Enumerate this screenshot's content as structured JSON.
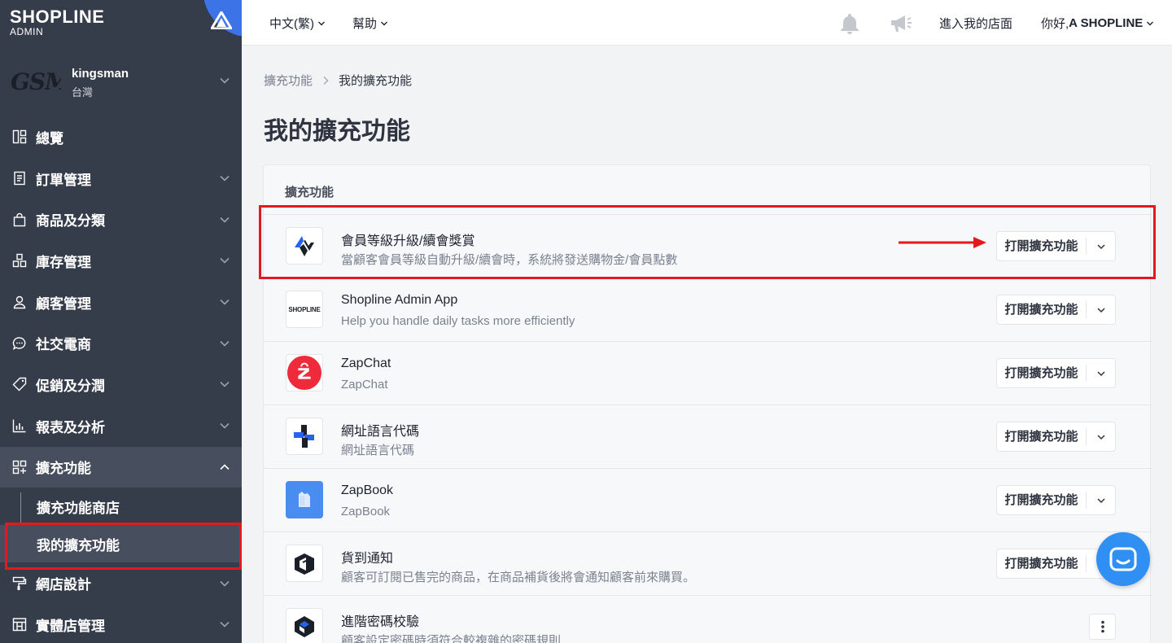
{
  "brand": {
    "name": "SHOPLINE",
    "sub": "ADMIN"
  },
  "store": {
    "logo": "GSM",
    "name": "kingsman",
    "region": "台灣"
  },
  "nav": {
    "overview": "總覽",
    "orders": "訂單管理",
    "products": "商品及分類",
    "inventory": "庫存管理",
    "customers": "顧客管理",
    "social": "社交電商",
    "promotions": "促銷及分潤",
    "reports": "報表及分析",
    "apps": "擴充功能",
    "apps_store": "擴充功能商店",
    "my_apps": "我的擴充功能",
    "design": "網店設計",
    "retail": "實體店管理"
  },
  "topbar": {
    "language": "中文(繁)",
    "help": "幫助",
    "visit_store": "進入我的店面",
    "greeting_prefix": "你好, ",
    "greeting_name": "A SHOPLINE"
  },
  "breadcrumb": {
    "parent": "擴充功能",
    "current": "我的擴充功能"
  },
  "page_title": "我的擴充功能",
  "card_header": "擴充功能",
  "apps": [
    {
      "title": "會員等級升級/續會獎賞",
      "desc": "當顧客會員等級自動升級/續會時，系統將發送購物金/會員點數",
      "button": "打開擴充功能",
      "icon": "membership-tier-icon"
    },
    {
      "title": "Shopline Admin App",
      "desc": "Help you handle daily tasks more efficiently",
      "button": "打開擴充功能",
      "icon": "shopline-logo-icon",
      "icon_text": "SHOPLINE"
    },
    {
      "title": "ZapChat",
      "desc": "ZapChat",
      "button": "打開擴充功能",
      "icon": "zapchat-icon"
    },
    {
      "title": "網址語言代碼",
      "desc": "網址語言代碼",
      "button": "打開擴充功能",
      "icon": "url-language-icon"
    },
    {
      "title": "ZapBook",
      "desc": "ZapBook",
      "button": "打開擴充功能",
      "icon": "zapbook-icon"
    },
    {
      "title": "貨到通知",
      "desc": "顧客可訂閱已售完的商品，在商品補貨後將會通知顧客前來購買。",
      "button": "打開擴充功能",
      "icon": "restock-notify-icon"
    },
    {
      "title": "進階密碼校驗",
      "desc": "顧客設定密碼時須符合較複雜的密碼規則",
      "icon": "advanced-password-icon"
    }
  ],
  "colors": {
    "sidebar": "#353c4a",
    "accent": "#3c73e6",
    "highlight": "#e3191d",
    "chat": "#2f8ff2"
  }
}
